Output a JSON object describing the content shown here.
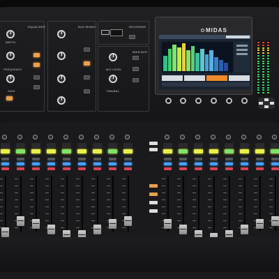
{
  "brand": {
    "logo_text": "MIDAS"
  },
  "sections": {
    "equaliser": "EQUALISER",
    "bus_sends": "BUS SENDS",
    "recorder": "RECORDER",
    "main_bus": "MAIN BUS"
  },
  "knob_labels": {
    "width": "WIDTH",
    "frequency": "FREQUENCY",
    "gain": "GAIN",
    "m_c_level": "M/C LEVEL",
    "pan_bal": "PAN/BAL"
  },
  "screen": {
    "tab_labels": [
      "",
      "",
      "",
      ""
    ],
    "display": "spectrum-analyzer"
  },
  "colors": {
    "select_lcd": "#e9f04a",
    "green_lcd": "#7ee36a",
    "blue_led": "#4aa0ff",
    "red_led": "#ff4a5a",
    "orange_button": "#e8a050",
    "meter_green": "#35d26a",
    "meter_red": "#ff4040"
  },
  "icons": [
    "usb-port-icon",
    "nav-button-cluster-icon"
  ]
}
